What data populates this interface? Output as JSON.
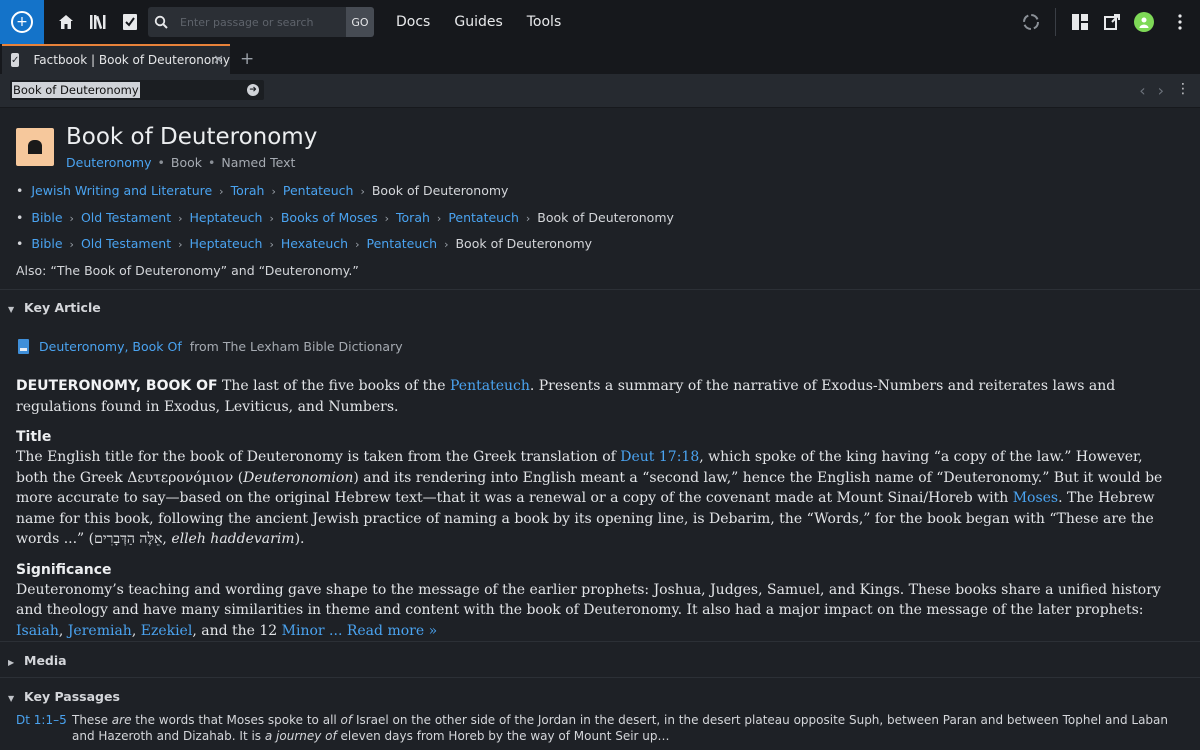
{
  "topbar": {
    "search_placeholder": "Enter passage or search",
    "go_label": "GO",
    "nav": [
      "Docs",
      "Guides",
      "Tools"
    ]
  },
  "tab": {
    "title": "Factbook | Book of Deuteronomy",
    "close": "✕",
    "add": "+"
  },
  "address": {
    "value": "Book of Deuteronomy"
  },
  "header": {
    "title": "Book of Deuteronomy",
    "sub_link": "Deuteronomy",
    "sub_type": "Book",
    "sub_kind": "Named Text"
  },
  "breadcrumbs": [
    {
      "links": [
        "Jewish Writing and Literature",
        "Torah",
        "Pentateuch"
      ],
      "current": "Book of Deuteronomy"
    },
    {
      "links": [
        "Bible",
        "Old Testament",
        "Heptateuch",
        "Books of Moses",
        "Torah",
        "Pentateuch"
      ],
      "current": "Book of Deuteronomy"
    },
    {
      "links": [
        "Bible",
        "Old Testament",
        "Heptateuch",
        "Hexateuch",
        "Pentateuch"
      ],
      "current": "Book of Deuteronomy"
    }
  ],
  "also": "Also: “The Book of Deuteronomy” and “Deuteronomy.”",
  "key_article": {
    "heading": "Key Article",
    "source_link": "Deuteronomy, Book Of",
    "source_from": "from The Lexham Bible Dictionary",
    "lead": "DEUTERONOMY, BOOK OF",
    "intro_a": " The last of the five books of the ",
    "intro_link": "Pentateuch",
    "intro_b": ". Presents a summary of the narrative of Exodus-Numbers and reiterates laws and regulations found in Exodus, Leviticus, and Numbers.",
    "title_heading": "Title",
    "title_a": "The English title for the book of Deuteronomy is taken from the Greek translation of ",
    "title_link1": "Deut 17:18",
    "title_b": ", which spoke of the king having “a copy of the law.” However, both the Greek Δευτερονόμιον (",
    "title_italic": "Deuteronomion",
    "title_c": ") and its rendering into English meant a “second law,” hence the English name of “Deuteronomy.” But it would be more accurate to say—based on the original Hebrew text—that it was a renewal or a copy of the covenant made at Mount Sinai/Horeb with ",
    "title_link2": "Moses",
    "title_d": ". The Hebrew name for this book, following the ancient Jewish practice of naming a book by its opening line, is Debarim, the “Words,” for the book began with “These are the words ...” (",
    "title_hebrew": "אֵלֶּה הַדְּבָרִים",
    "title_e": ", ",
    "title_italic2": "elleh haddevarim",
    "title_f": ").",
    "sig_heading": "Significance",
    "sig_a": "Deuteronomy’s teaching and wording gave shape to the message of the earlier prophets: Joshua, Judges, Samuel, and Kings. These books share a unified history and theology and have many similarities in theme and content with the book of Deuteronomy. It also had a major impact on the message of the later prophets: ",
    "sig_link1": "Isaiah",
    "sig_sep1": ", ",
    "sig_link2": "Jeremiah",
    "sig_sep2": ", ",
    "sig_link3": "Ezekiel",
    "sig_b": ", and the 12 ",
    "sig_link4": "Minor",
    "sig_more": " ... Read more »"
  },
  "media": {
    "heading": "Media"
  },
  "key_passages": {
    "heading": "Key Passages",
    "ref": "Dt 1:1–5",
    "t1": "These ",
    "t1i": "are",
    "t2": " the words that Moses spoke to all ",
    "t2i": "of",
    "t3": " Israel on the other side of the Jordan in the desert, in the desert plateau opposite Suph, between Paran and between Tophel and Laban and Hazeroth and Dizahab. It is ",
    "t3i": "a journey of",
    "t4": " eleven days from Horeb by the way of Mount Seir up…"
  },
  "colors": {
    "accent": "#4aa3f0",
    "logo_bg": "#1473c9",
    "tab_accent": "#e8823a",
    "avatar": "#7ed957",
    "header_icon_bg": "#f6c89c"
  }
}
